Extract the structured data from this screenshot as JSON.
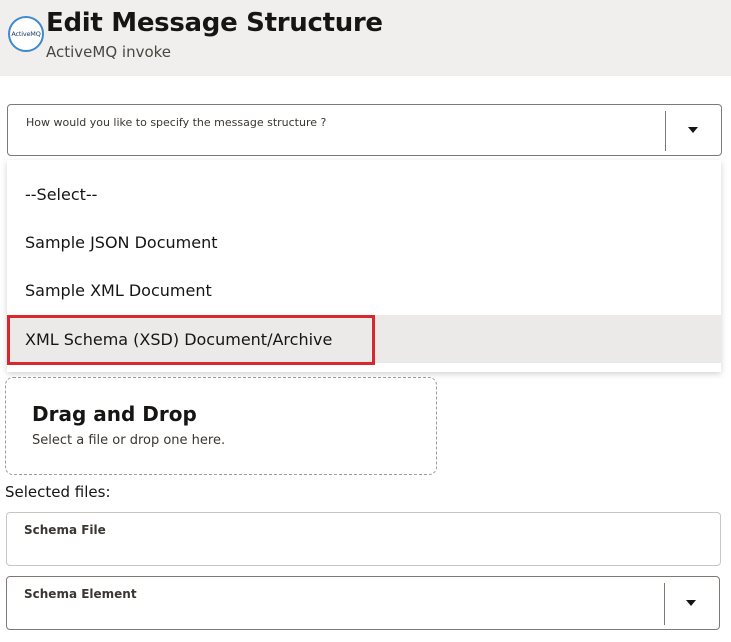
{
  "header": {
    "logo_text": "ActiveMQ",
    "title": "Edit Message Structure",
    "subtitle": "ActiveMQ invoke"
  },
  "structure_select": {
    "label": "How would you like to specify the message structure ?",
    "options": [
      "--Select--",
      "Sample JSON Document",
      "Sample XML Document",
      "XML Schema (XSD) Document/Archive"
    ],
    "highlighted_option": "XML Schema (XSD) Document/Archive"
  },
  "dropzone": {
    "title": "Drag and Drop",
    "subtitle": "Select a file or drop one here."
  },
  "selected_files_label": "Selected files:",
  "schema_file": {
    "label": "Schema File",
    "value": ""
  },
  "schema_element": {
    "label": "Schema Element",
    "value": ""
  },
  "icons": {
    "dropdown_caret": "caret-down-icon"
  },
  "colors": {
    "highlight_border": "#d9272e",
    "header_bg": "#f1efed",
    "option_highlight_bg": "#eceae8"
  }
}
